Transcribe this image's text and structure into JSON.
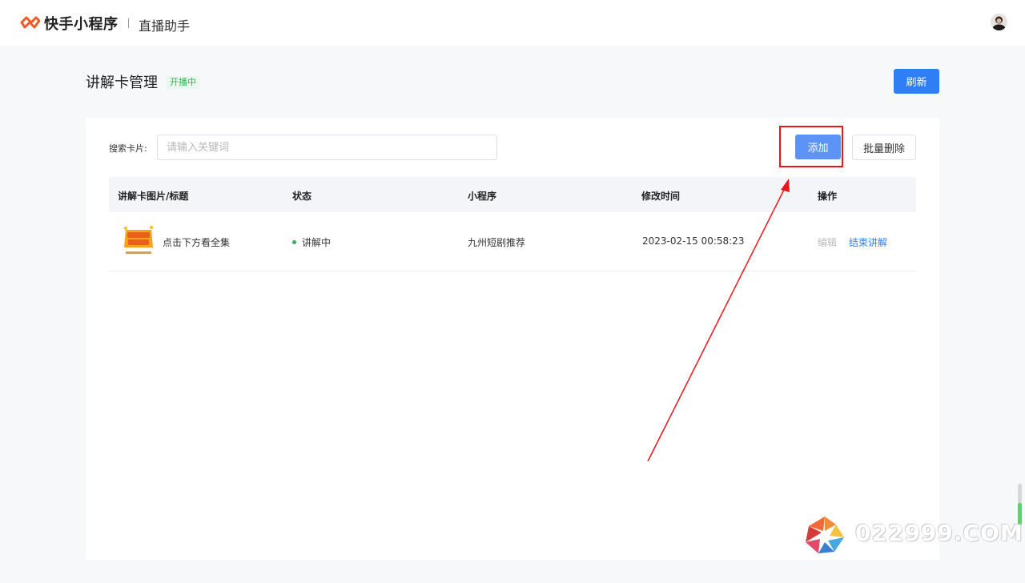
{
  "header": {
    "brand": "快手小程序",
    "subtitle": "直播助手",
    "accent": "#f15a24"
  },
  "page": {
    "title": "讲解卡管理",
    "status_badge": "开播中",
    "refresh_label": "刷新"
  },
  "toolbar": {
    "search_label": "搜索卡片:",
    "search_placeholder": "请输入关键词",
    "search_value": "",
    "add_label": "添加",
    "bulk_delete_label": "批量删除"
  },
  "table": {
    "columns": [
      "讲解卡图片/标题",
      "状态",
      "小程序",
      "修改时间",
      "操作"
    ],
    "rows": [
      {
        "title": "点击下方看全集",
        "status": "讲解中",
        "miniprogram": "九州短剧推荐",
        "modified": "2023-02-15 00:58:23",
        "edit_label": "编辑",
        "end_label": "结束讲解"
      }
    ]
  },
  "watermark": {
    "text": "022999.COM"
  },
  "colors": {
    "primary": "#2e7ff6",
    "success": "#2bb54e",
    "annotation": "#e8161e"
  }
}
